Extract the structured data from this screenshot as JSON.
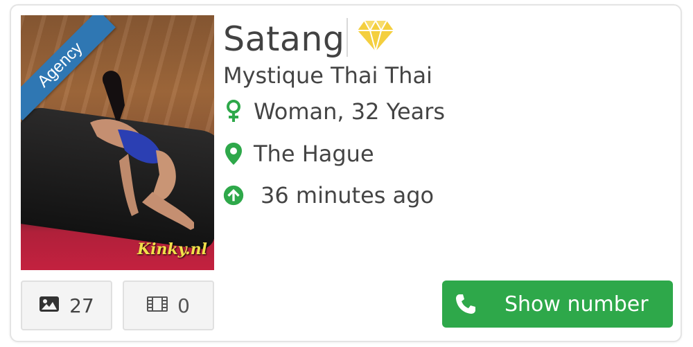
{
  "profile": {
    "name": "Satang",
    "agency": "Mystique Thai Thai",
    "ribbon": "Agency",
    "watermark": "Kinky.nl",
    "gender_age": "Woman, 32 Years",
    "city": "The Hague",
    "updated": "36 minutes ago",
    "premium_icon": "diamond-icon"
  },
  "stats": {
    "photos": "27",
    "videos": "0"
  },
  "actions": {
    "show_number": "Show number"
  },
  "colors": {
    "accent_green": "#2ea84a",
    "ribbon_blue": "#2f77b3",
    "diamond_gold": "#f4cf3f"
  }
}
